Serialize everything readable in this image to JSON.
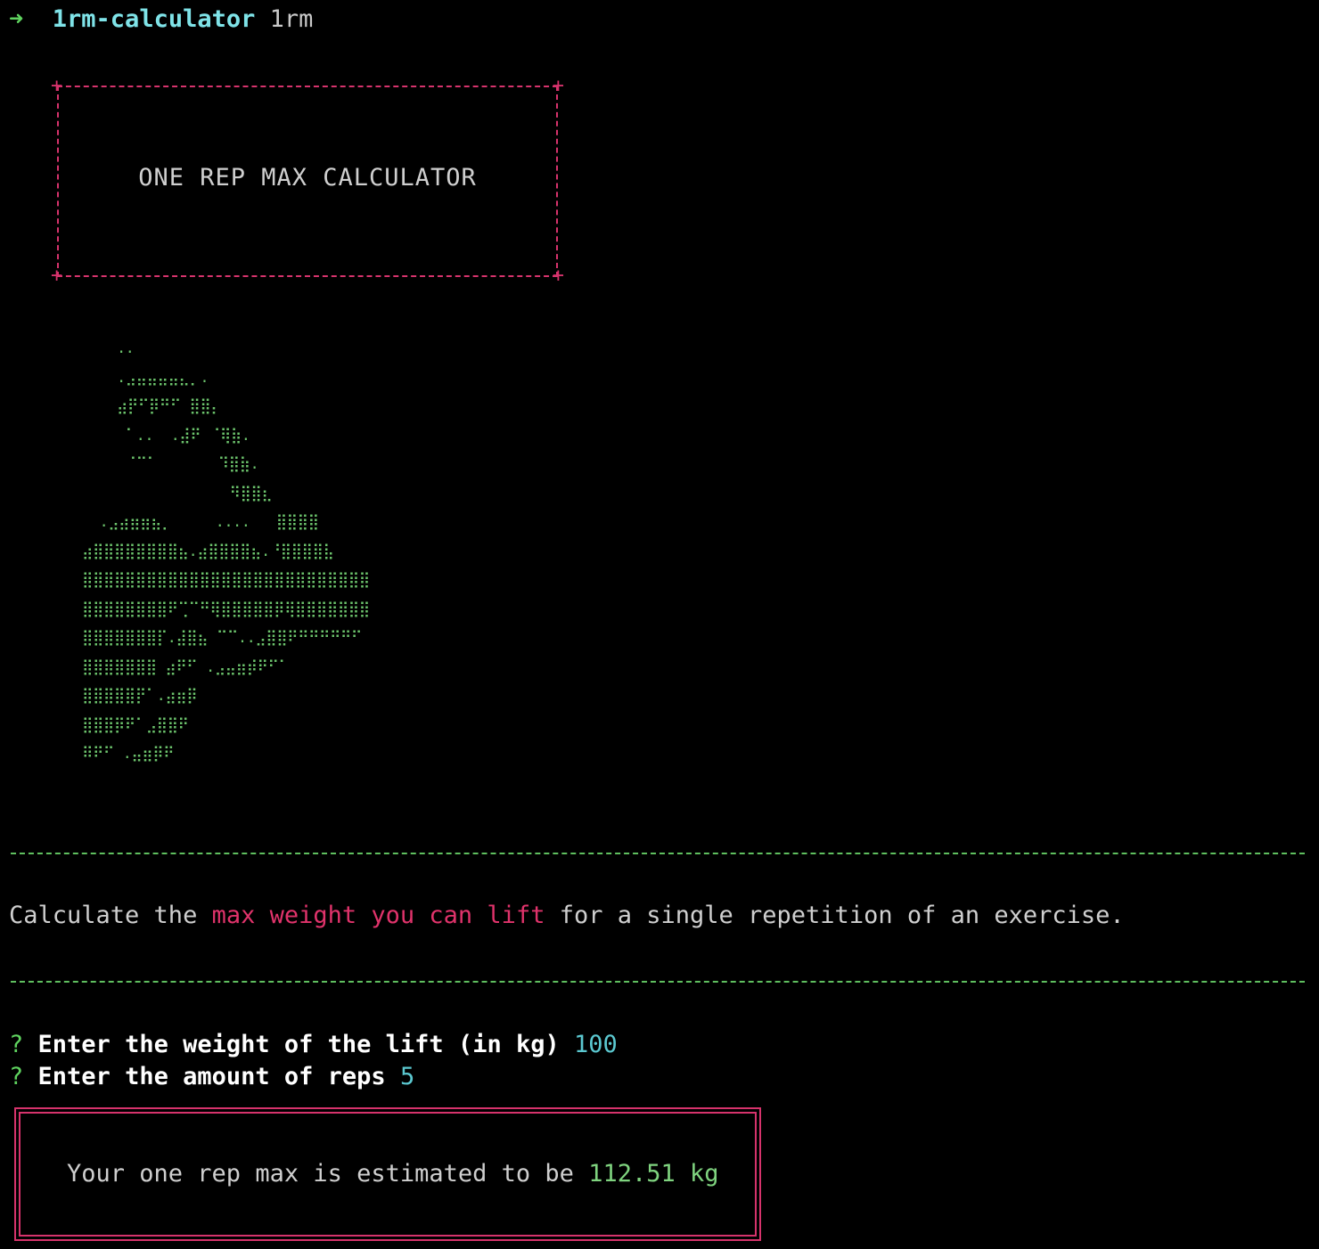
{
  "prompt": {
    "arrow": "➜",
    "directory": "1rm-calculator",
    "command": "1rm"
  },
  "banner": {
    "corner": "+",
    "title": "ONE REP MAX CALCULATOR"
  },
  "ascii_art": "    ..\n    .⣠⣤⣤⣤⣤⣄⡀.\n    ⣴⡟⠋⡿⠛⠋ ⣿⣿⡄\n     ⠁..  .⣼⠟ ⠈⢿⣷.\n     ⠈⠉⠁       ⠹⣿⣷.\n                 ⠻⣿⣿⣆\n  .⣠⣴⣶⣶⣦⡀     ....   ⣿⣿⣿⣿\n⣴⣿⣿⣿⣿⣿⣿⣿⣿⣦.⣴⣿⣿⣿⣿⣦.⠘⣿⣿⣿⣿⣧\n⣿⣿⣿⣿⣿⣿⣿⣿⣿⣿⣿⣿⣿⣿⣿⣿⣿⣿⣿⣿⣿⣿⣿⣿⣿⣿⣿\n⣿⣿⣿⣿⣿⣿⣿⣿⠟⢉⠉⠛⢿⣿⣿⣿⣿⣿⡿⢿⣿⣿⣿⣿⣿⣿⣿\n⣿⣿⣿⣿⣿⣿⣿⡏.⣼⣿⣦ ⠉⠉..⣠⣿⣿⠟⠛⠛⠛⠛⠛⠋\n⣿⣿⣿⣿⣿⣿⣿ ⣴⠟⠋ .⣠⣤⣶⡾⠟⠋⠁\n⣿⣿⣿⣿⣿⡟⠁.⣴⣶⡿\n⣿⣿⣿⡿⠟⠁⣠⣿⣿⠟\n⠿⠟⠋ .⣤⣶⡿⠟",
  "description": {
    "before": "Calculate the ",
    "highlight": "max weight you can lift",
    "after": " for a single repetition of an exercise."
  },
  "questions": [
    {
      "mark": "?",
      "label": "Enter the weight of the lift (in kg)",
      "answer": "100"
    },
    {
      "mark": "?",
      "label": "Enter the amount of reps",
      "answer": "5"
    }
  ],
  "result": {
    "text": "Your one rep max is estimated to be ",
    "value": "112.51 kg"
  },
  "colors": {
    "background": "#000000",
    "accent_pink": "#d6336c",
    "accent_green": "#5fbf5f",
    "answer_cyan": "#5bc8d0"
  }
}
